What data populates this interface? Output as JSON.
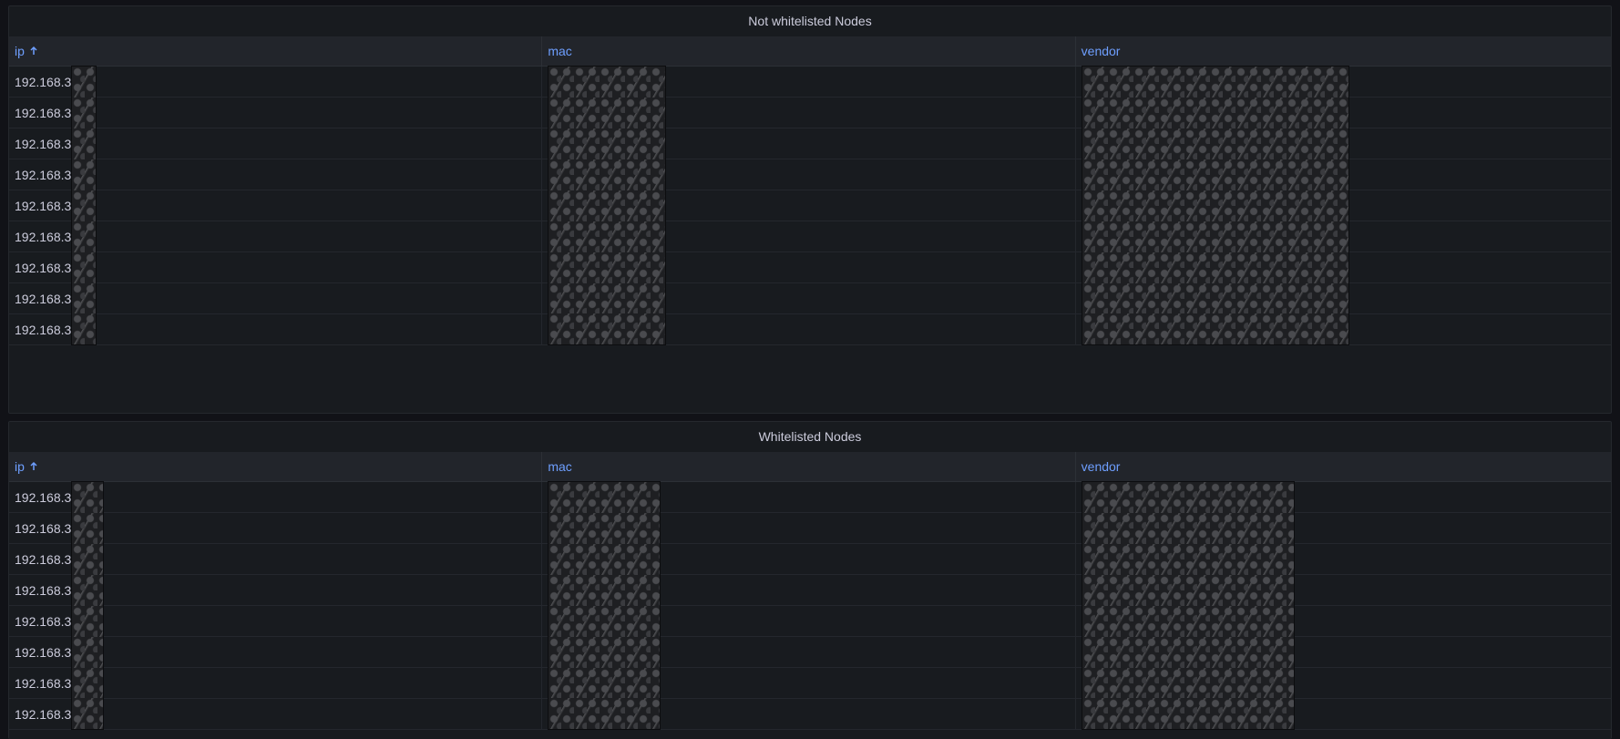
{
  "panels": [
    {
      "title": "Not whitelisted Nodes",
      "columns": [
        {
          "label": "ip",
          "sorted": "ascending"
        },
        {
          "label": "mac"
        },
        {
          "label": "vendor"
        }
      ],
      "rows": [
        {
          "ip": "192.168.3"
        },
        {
          "ip": "192.168.3"
        },
        {
          "ip": "192.168.3"
        },
        {
          "ip": "192.168.3"
        },
        {
          "ip": "192.168.3"
        },
        {
          "ip": "192.168.3"
        },
        {
          "ip": "192.168.3"
        },
        {
          "ip": "192.168.3"
        },
        {
          "ip": "192.168.3"
        }
      ]
    },
    {
      "title": "Whitelisted Nodes",
      "columns": [
        {
          "label": "ip",
          "sorted": "ascending"
        },
        {
          "label": "mac"
        },
        {
          "label": "vendor"
        }
      ],
      "rows": [
        {
          "ip": "192.168.3"
        },
        {
          "ip": "192.168.3"
        },
        {
          "ip": "192.168.3"
        },
        {
          "ip": "192.168.3"
        },
        {
          "ip": "192.168.3"
        },
        {
          "ip": "192.168.3"
        },
        {
          "ip": "192.168.3"
        },
        {
          "ip": "192.168.3"
        }
      ]
    }
  ],
  "theme": {
    "background": "#111217",
    "panel": "#181b1f",
    "header": "#22252b",
    "link": "#6e9fff",
    "text": "#ccccdc"
  },
  "icons": {
    "sort": "arrow-up-icon"
  }
}
